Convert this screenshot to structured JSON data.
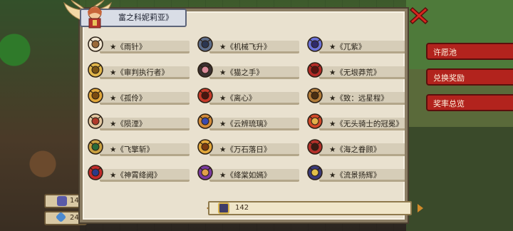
{
  "header": {
    "hero_name": "富之科妮莉亚》"
  },
  "items": [
    {
      "label": "★《雨针》",
      "icon": "wand-icon"
    },
    {
      "label": "★《机械飞升》",
      "icon": "mech-wing-icon"
    },
    {
      "label": "★《兀紫》",
      "icon": "purple-crystal-icon"
    },
    {
      "label": "★《审判执行者》",
      "icon": "golden-armor-icon"
    },
    {
      "label": "★《猫之手》",
      "icon": "cat-paw-icon"
    },
    {
      "label": "★《无垠莽荒》",
      "icon": "red-helmet-icon"
    },
    {
      "label": "★《孤伶》",
      "icon": "gold-ring-icon"
    },
    {
      "label": "★《离心》",
      "icon": "red-blade-icon"
    },
    {
      "label": "★《致：远星程》",
      "icon": "bronze-helmet-icon"
    },
    {
      "label": "★《陨湮》",
      "icon": "meteor-staff-icon"
    },
    {
      "label": "★《云辨琉璃》",
      "icon": "orb-ring-icon"
    },
    {
      "label": "★《无头骑士的冠冕》",
      "icon": "crown-icon"
    },
    {
      "label": "★《飞擎斩》",
      "icon": "cross-sword-icon"
    },
    {
      "label": "★《万石落日》",
      "icon": "golden-bow-icon"
    },
    {
      "label": "★《海之眷顾》",
      "icon": "trident-icon"
    },
    {
      "label": "★《神霄绛阙》",
      "icon": "red-amulet-icon"
    },
    {
      "label": "★《绛棠如嫣》",
      "icon": "flower-fan-icon"
    },
    {
      "label": "★《流景扬辉》",
      "icon": "shield-emblem-icon"
    }
  ],
  "footer": {
    "count": "142"
  },
  "background": {
    "side_buttons": [
      "许愿池",
      "兑换奖励",
      "奖率总览"
    ],
    "resources": [
      "14",
      "24"
    ]
  },
  "colors": {
    "panel_bg": "#e9e1cf",
    "close_red": "#d8261f",
    "side_button_red": "#b2231d"
  }
}
